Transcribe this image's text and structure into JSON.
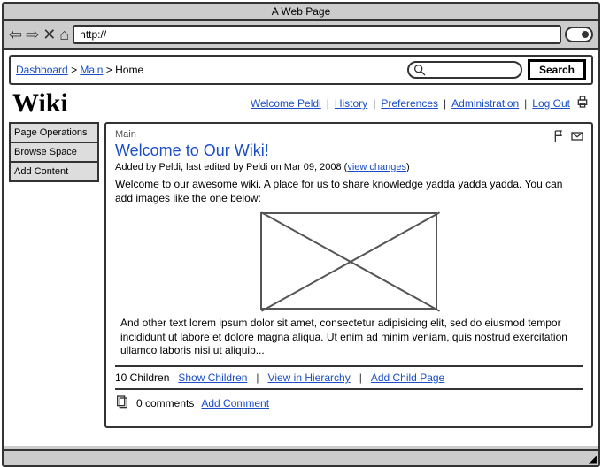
{
  "browser": {
    "title": "A Web Page",
    "url": "http://"
  },
  "breadcrumb": {
    "items": [
      "Dashboard",
      "Main",
      "Home"
    ]
  },
  "search": {
    "button": "Search"
  },
  "logo": "Wiki",
  "header_links": [
    "Welcome Peldi",
    "History",
    "Preferences",
    "Administration",
    "Log Out"
  ],
  "sidebar": {
    "items": [
      "Page Operations",
      "Browse Space",
      "Add Content"
    ]
  },
  "panel": {
    "crumb": "Main",
    "title": "Welcome to Our Wiki!",
    "byline_prefix": "Added by Peldi, last edited by Peldi on Mar 09, 2008 (",
    "byline_link": "view changes",
    "byline_suffix": ")",
    "intro": "Welcome to our awesome wiki. A place for us to share knowledge yadda yadda yadda. You can add images like the one below:",
    "more": "And other text lorem ipsum dolor sit amet, consectetur adipisicing elit, sed do eiusmod tempor incididunt ut labore et dolore magna aliqua. Ut enim ad minim veniam, quis nostrud exercitation ullamco laboris nisi ut aliquip...",
    "children_count": "10 Children",
    "children_links": [
      "Show Children",
      "View in Hierarchy",
      "Add Child Page"
    ],
    "comments_count": "0 comments",
    "add_comment": "Add Comment"
  }
}
